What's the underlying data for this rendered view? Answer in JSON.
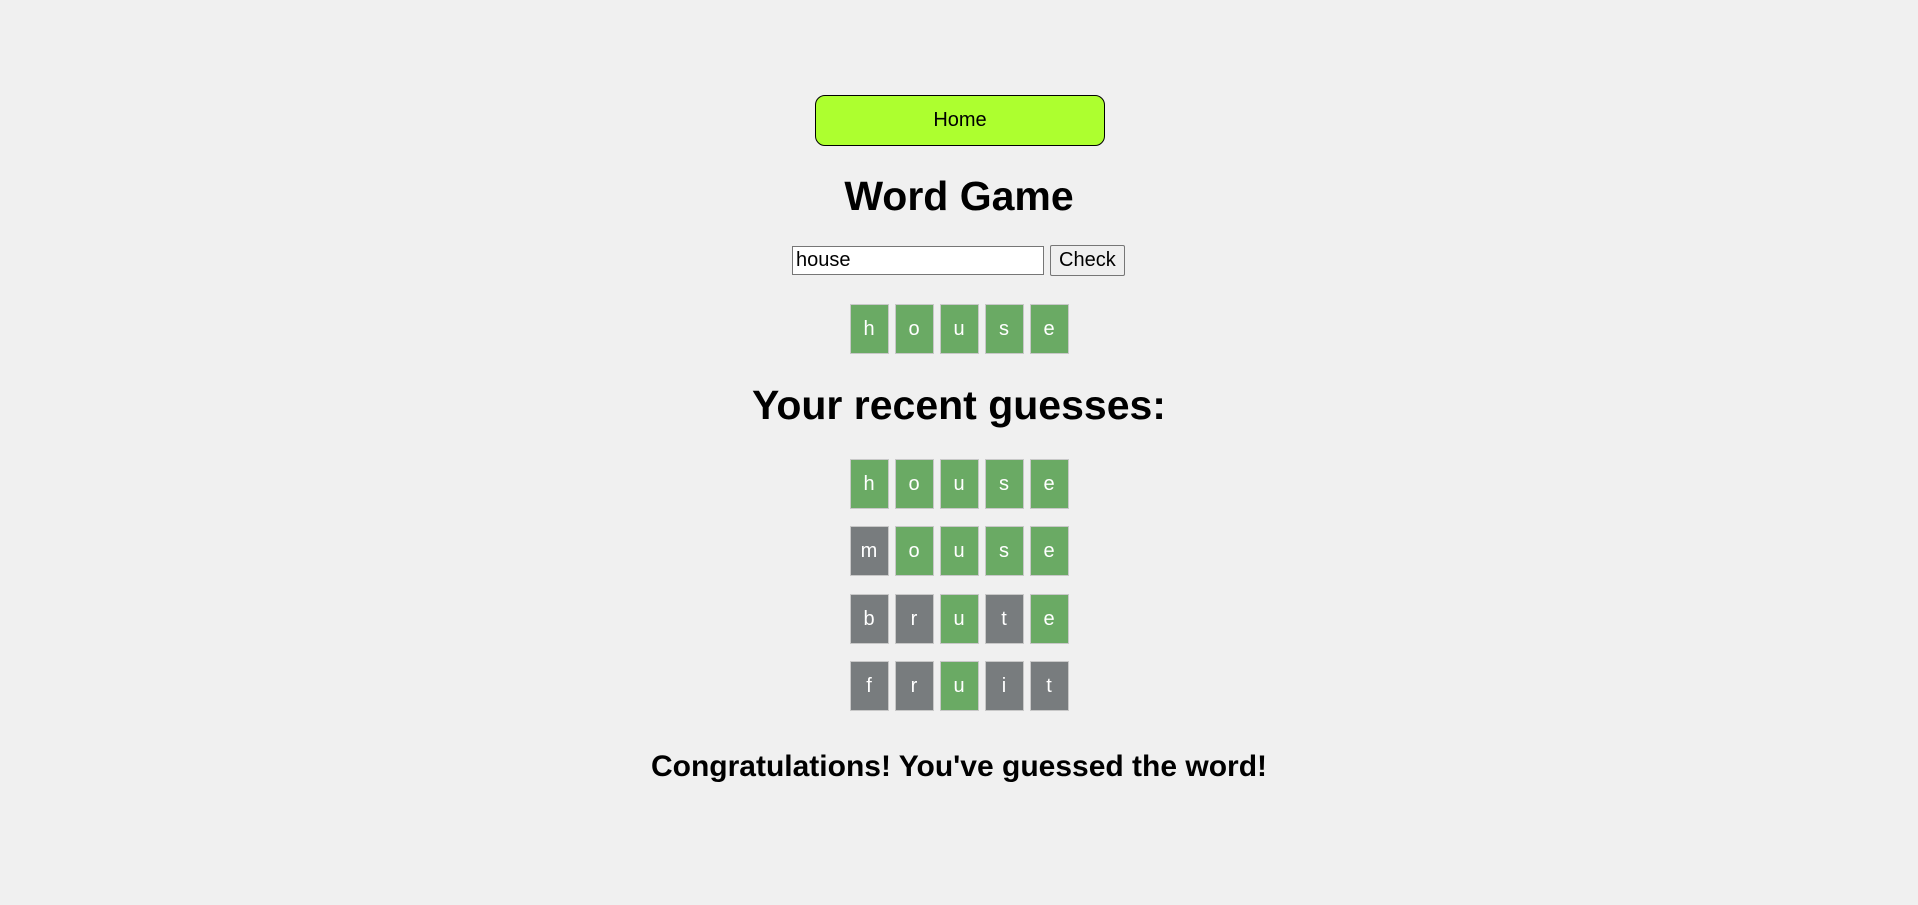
{
  "nav": {
    "home_label": "Home"
  },
  "game": {
    "title": "Word Game",
    "input_value": "house",
    "check_label": "Check",
    "current": [
      {
        "letter": "h",
        "state": "correct"
      },
      {
        "letter": "o",
        "state": "correct"
      },
      {
        "letter": "u",
        "state": "correct"
      },
      {
        "letter": "s",
        "state": "correct"
      },
      {
        "letter": "e",
        "state": "correct"
      }
    ]
  },
  "recent": {
    "title": "Your recent guesses:",
    "guesses": [
      [
        {
          "letter": "h",
          "state": "correct"
        },
        {
          "letter": "o",
          "state": "correct"
        },
        {
          "letter": "u",
          "state": "correct"
        },
        {
          "letter": "s",
          "state": "correct"
        },
        {
          "letter": "e",
          "state": "correct"
        }
      ],
      [
        {
          "letter": "m",
          "state": "absent"
        },
        {
          "letter": "o",
          "state": "correct"
        },
        {
          "letter": "u",
          "state": "correct"
        },
        {
          "letter": "s",
          "state": "correct"
        },
        {
          "letter": "e",
          "state": "correct"
        }
      ],
      [
        {
          "letter": "b",
          "state": "absent"
        },
        {
          "letter": "r",
          "state": "absent"
        },
        {
          "letter": "u",
          "state": "correct"
        },
        {
          "letter": "t",
          "state": "absent"
        },
        {
          "letter": "e",
          "state": "correct"
        }
      ],
      [
        {
          "letter": "f",
          "state": "absent"
        },
        {
          "letter": "r",
          "state": "absent"
        },
        {
          "letter": "u",
          "state": "correct"
        },
        {
          "letter": "i",
          "state": "absent"
        },
        {
          "letter": "t",
          "state": "absent"
        }
      ]
    ]
  },
  "result": {
    "message": "Congratulations! You've guessed the word!"
  },
  "colors": {
    "home_button": "#adff2f",
    "correct": "#6aaa64",
    "absent": "#787c7e",
    "background": "#f0f0f0"
  }
}
